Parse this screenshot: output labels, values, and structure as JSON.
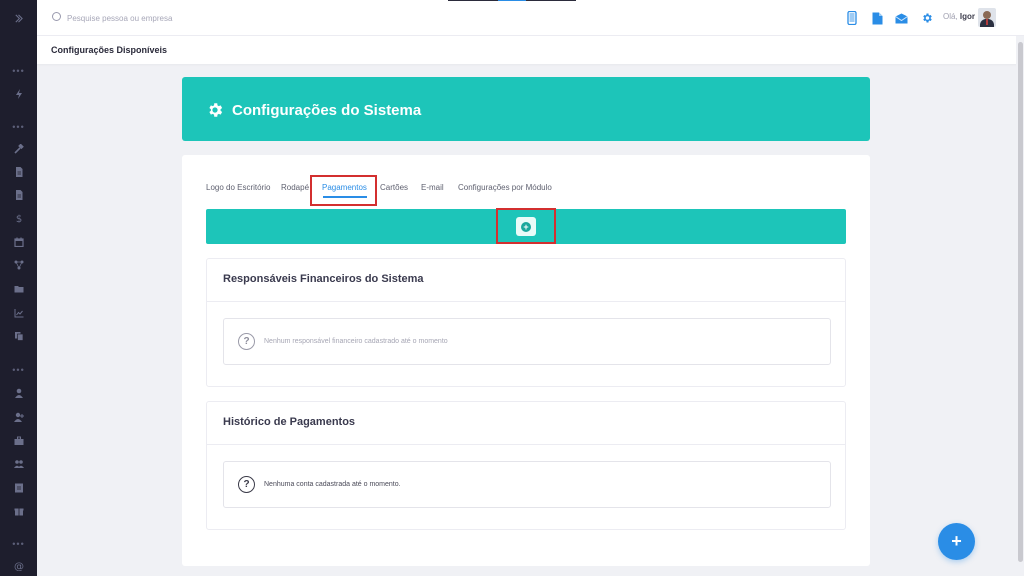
{
  "topbar": {
    "search_placeholder": "Pesquise pessoa ou empresa",
    "greeting_prefix": "Olá,",
    "user_name": "Igor"
  },
  "subheader": {
    "title": "Configurações Disponíveis"
  },
  "banner": {
    "title": "Configurações do Sistema",
    "icon": "gear-icon"
  },
  "tabs": [
    {
      "label": "Logo do Escritório",
      "active": false
    },
    {
      "label": "Rodapé",
      "active": false
    },
    {
      "label": "Pagamentos",
      "active": true
    },
    {
      "label": "Cartões",
      "active": false
    },
    {
      "label": "E-mail",
      "active": false
    },
    {
      "label": "Configurações por Módulo",
      "active": false
    }
  ],
  "panels": {
    "responsaveis": {
      "title": "Responsáveis Financeiros do Sistema",
      "empty_text": "Nenhum responsável financeiro cadastrado até o momento"
    },
    "historico": {
      "title": "Histórico de Pagamentos",
      "empty_text": "Nenhuma conta cadastrada até o momento."
    }
  },
  "colors": {
    "accent": "#1dc5b9",
    "primary": "#2a8de6",
    "sidebar": "#1e1e2d",
    "highlight": "#d32f2f"
  },
  "icons": {
    "sidebar": [
      "chevron-right-icon",
      "dots-icon",
      "bolt-icon",
      "dots-icon",
      "hammer-icon",
      "document-icon",
      "document-icon",
      "dollar-icon",
      "calendar-icon",
      "network-icon",
      "folder-icon",
      "chart-icon",
      "copy-icon",
      "dots-icon",
      "user-icon",
      "user-plus-icon",
      "briefcase-icon",
      "users-icon",
      "id-card-icon",
      "gift-icon",
      "dots-icon",
      "at-icon"
    ],
    "topbar": [
      "phone-icon",
      "file-icon",
      "mail-icon",
      "gear-icon"
    ]
  }
}
